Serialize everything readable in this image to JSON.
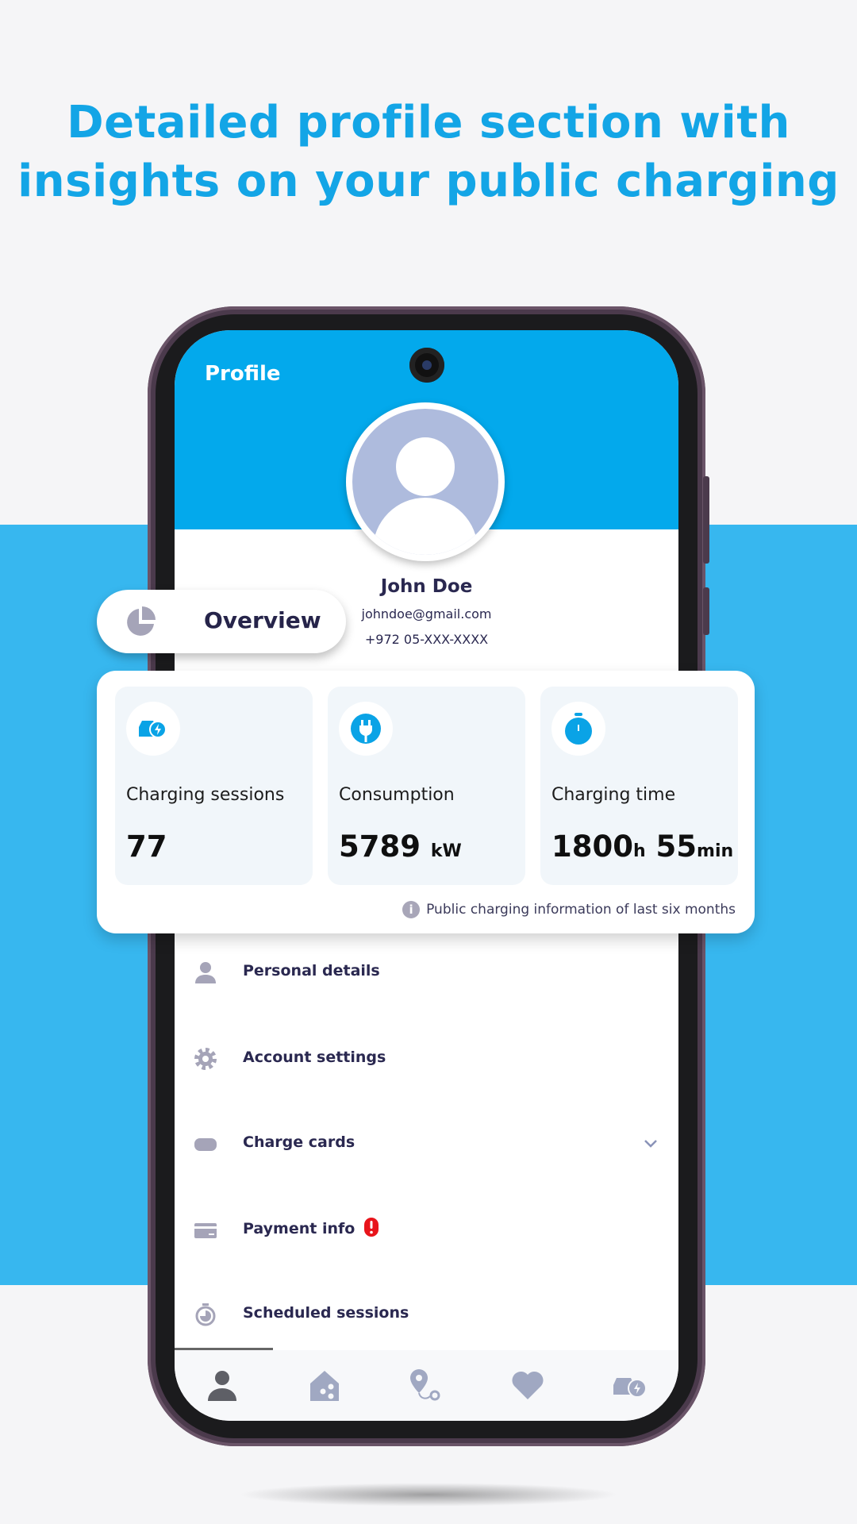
{
  "headline": {
    "line1": "Detailed profile section with",
    "line2": "insights on your public charging"
  },
  "colors": {
    "brand_blue": "#03a9ec",
    "band_blue": "#37b7ef",
    "headline_blue": "#13a5e6",
    "text_dark": "#2a2850",
    "icon_gray": "#a5a4b8",
    "alert_red": "#e8141b"
  },
  "screen": {
    "title": "Profile",
    "user": {
      "name": "John Doe",
      "email": "johndoe@gmail.com",
      "phone": "+972 05-XXX-XXXX"
    },
    "overview_tab": {
      "icon": "pie-chart-icon",
      "label": "Overview"
    },
    "stats": [
      {
        "icon": "car-charging-icon",
        "label": "Charging sessions",
        "value": "77",
        "unit": ""
      },
      {
        "icon": "plug-icon",
        "label": "Consumption",
        "value": "5789",
        "unit": "kW"
      },
      {
        "icon": "stopwatch-icon",
        "label": "Charging time",
        "hours": "1800",
        "hours_unit": "h",
        "minutes": "55",
        "minutes_unit": "min"
      }
    ],
    "stats_note": "Public charging information of last six months",
    "menu": [
      {
        "icon": "person-icon",
        "label": "Personal details"
      },
      {
        "icon": "gear-icon",
        "label": "Account settings"
      },
      {
        "icon": "card-icon",
        "label": "Charge cards",
        "expandable": true
      },
      {
        "icon": "credit-card-icon",
        "label": "Payment info",
        "alert": true
      },
      {
        "icon": "timer-icon",
        "label": "Scheduled sessions"
      }
    ],
    "nav": [
      {
        "icon": "profile-icon",
        "active": true
      },
      {
        "icon": "home-share-icon"
      },
      {
        "icon": "route-icon"
      },
      {
        "icon": "heart-icon"
      },
      {
        "icon": "car-charging-icon"
      }
    ]
  }
}
